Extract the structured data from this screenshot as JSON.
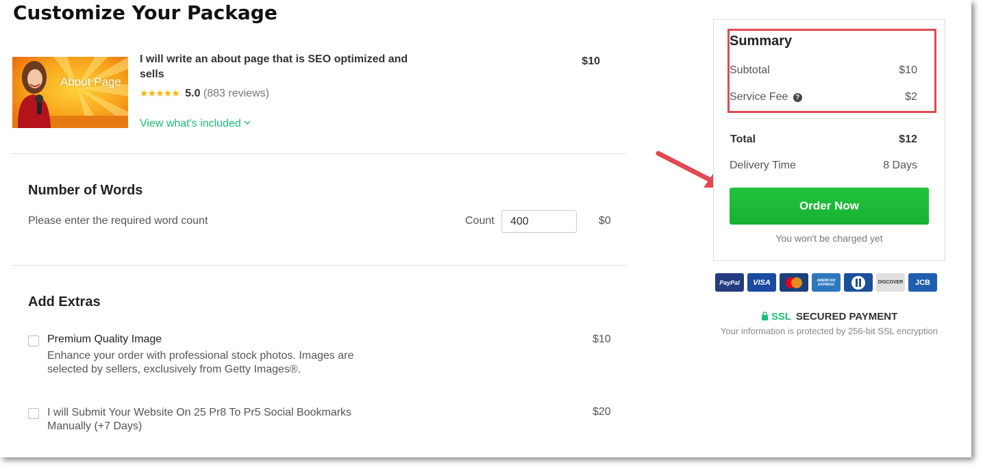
{
  "page": {
    "title": "Customize Your Package"
  },
  "gig": {
    "thumbnail_text": "About Page",
    "title": "I will write an about page that is SEO optimized and sells",
    "stars": "★★★★★",
    "rating": "5.0",
    "reviews": "(883 reviews)",
    "view_link": "View what's included",
    "price": "$10"
  },
  "words": {
    "section_title": "Number of Words",
    "description": "Please enter the required word count",
    "count_label": "Count",
    "count_value": "400",
    "price": "$0"
  },
  "extras": {
    "section_title": "Add Extras",
    "items": [
      {
        "name": "Premium Quality Image",
        "description": "Enhance your order with professional stock photos. Images are selected by sellers, exclusively from Getty Images®.",
        "price": "$10",
        "checked": false
      },
      {
        "name": "I will Submit Your Website On 25 Pr8 To Pr5 Social Bookmarks Manually (+7 Days)",
        "price": "$20",
        "checked": false
      }
    ]
  },
  "summary": {
    "title": "Summary",
    "subtotal_label": "Subtotal",
    "subtotal_value": "$10",
    "service_fee_label": "Service Fee",
    "service_fee_value": "$2",
    "total_label": "Total",
    "total_value": "$12",
    "delivery_label": "Delivery Time",
    "delivery_value": "8 Days",
    "order_button": "Order Now",
    "charge_note": "You won't be charged yet"
  },
  "payment": {
    "methods": [
      {
        "label": "PayPal",
        "bg": "#253b80"
      },
      {
        "label": "VISA",
        "bg": "#1a4ba0"
      },
      {
        "label": "MasterCard",
        "bg": "#1c3f7a"
      },
      {
        "label": "AMERICAN EXPRESS",
        "bg": "#2e77bc"
      },
      {
        "label": "Diners",
        "bg": "#1b4e9b"
      },
      {
        "label": "DISCOVER",
        "bg": "#e0e0e0"
      },
      {
        "label": "JCB",
        "bg": "#1f5fae"
      }
    ],
    "ssl_label": "SSL",
    "secured_label": "SECURED PAYMENT",
    "ssl_note": "Your information is protected by 256-bit SSL encryption"
  },
  "colors": {
    "accent_green": "#1dbf73",
    "button_green": "#1dbf38",
    "highlight_red": "#e14952",
    "star_gold": "#f7b500"
  }
}
